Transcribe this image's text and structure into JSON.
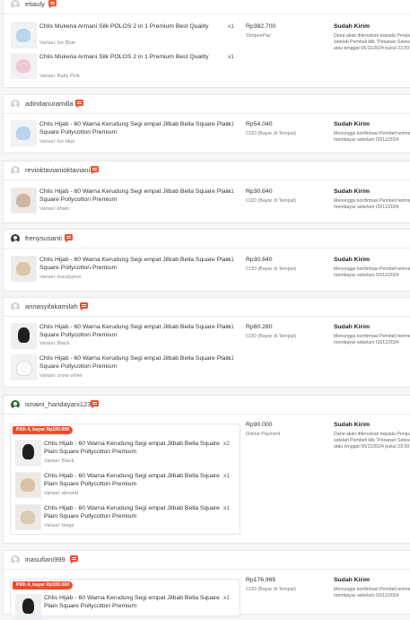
{
  "orders": [
    {
      "username": "etiauly",
      "items": [
        {
          "name": "Chlis Mukena Armani Silk POLOS 2 in 1 Premium Best Quality",
          "variation": "Variasi: Ice Blue",
          "qty": "x1"
        },
        {
          "name": "Chlis Mukena Armani Silk POLOS 2 in 1 Premium Best Quality",
          "variation": "Variasi: Baby Pink",
          "qty": "x1"
        }
      ],
      "price": "Rp382.700",
      "payment": "ShopeePay",
      "status": "Sudah Kirim",
      "note": "Dana akan diteruskan kepada Penjual setelah Pembeli klik \"Pesanan Selesai\" atau tenggat 05/11/2024 pukul 23.59"
    },
    {
      "username": "adindanuramilla",
      "items": [
        {
          "name": "Chlis Hijab - 60 Warna Kerudung Segi empat Jilbab Bella Square Plain Square Pollycotton Premium",
          "variation": "Variasi: Ice blue",
          "qty": "x1"
        }
      ],
      "price": "Rp54.040",
      "payment": "COD (Bayar di Tempat)",
      "status": "Sudah Kirim",
      "note": "Menunggu konfirmasi Pembeli terima membayar sebelum 03/11/2024"
    },
    {
      "username": "revioktavianioktaviani",
      "items": [
        {
          "name": "Chlis Hijab - 60 Warna Kerudung Segi empat Jilbab Bella Square Plain Square Pollycotton Premium",
          "variation": "Variasi: khaki",
          "qty": "x1"
        }
      ],
      "price": "Rp30.640",
      "payment": "COD (Bayar di Tempat)",
      "status": "Sudah Kirim",
      "note": "Menunggu konfirmasi Pembeli terima membayar sebelum 03/11/2024"
    },
    {
      "username": "frenysusanti",
      "items": [
        {
          "name": "Chlis Hijab - 60 Warna Kerudung Segi empat Jilbab Bella Square Plain Square Pollycotton Premium",
          "variation": "Variasi: eucalyptus",
          "qty": "x1"
        }
      ],
      "price": "Rp30.640",
      "payment": "COD (Bayar di Tempat)",
      "status": "Sudah Kirim",
      "note": "Menunggu konfirmasi Pembeli terima membayar sebelum 03/11/2024"
    },
    {
      "username": "arinasyifakamilah",
      "items": [
        {
          "name": "Chlis Hijab - 60 Warna Kerudung Segi empat Jilbab Bella Square Plain Square Pollycotton Premium",
          "variation": "Variasi: Black",
          "qty": "x1"
        },
        {
          "name": "Chlis Hijab - 60 Warna Kerudung Segi empat Jilbab Bella Square Plain Square Pollycotton Premium",
          "variation": "Variasi: snow white",
          "qty": "x1"
        }
      ],
      "price": "Rp60.280",
      "payment": "COD (Bayar di Tempat)",
      "status": "Sudah Kirim",
      "note": "Menunggu konfirmasi Pembeli terima membayar sebelum 03/11/2024"
    },
    {
      "username": "isnaini_handayani123",
      "bundle_tag": "Pilih 4, bayar Rp100.000",
      "items": [
        {
          "name": "Chlis Hijab - 60 Warna Kerudung Segi empat Jilbab Bella Square Plain Square Pollycotton Premium",
          "variation": "Variasi: Black",
          "qty": "x2"
        },
        {
          "name": "Chlis Hijab - 60 Warna Kerudung Segi empat Jilbab Bella Square Plain Square Pollycotton Premium",
          "variation": "Variasi: almond",
          "qty": "x1"
        },
        {
          "name": "Chlis Hijab - 60 Warna Kerudung Segi empat Jilbab Bella Square Plain Square Pollycotton Premium",
          "variation": "Variasi: beige",
          "qty": "x1"
        }
      ],
      "price": "Rp90.000",
      "payment": "Online Payment",
      "status": "Sudah Kirim",
      "note": "Dana akan diteruskan kepada Penjual setelah Pembeli klik \"Pesanan Selesai\" atau tenggat 05/11/2024 pukul 23.59"
    },
    {
      "username": "inasufiani999",
      "bundle_tag": "Pilih 4, bayar Rp100.000",
      "items": [
        {
          "name": "Chlis Hijab - 60 Warna Kerudung Segi empat Jilbab Bella Square Plain Square Pollycotton Premium",
          "variation": "",
          "qty": "x1"
        }
      ],
      "price": "Rp176.965",
      "payment": "COD (Bayar di Tempat)",
      "status": "Sudah Kirim",
      "note": "Menunggu konfirmasi Pembeli terima membayar sebelum 03/11/2024"
    }
  ]
}
